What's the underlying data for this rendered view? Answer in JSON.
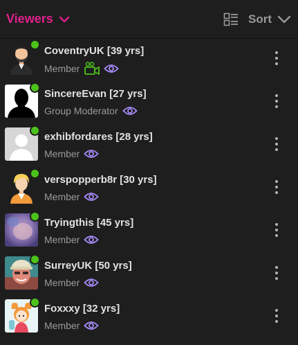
{
  "header": {
    "title": "Viewers",
    "sort_label": "Sort",
    "accent_color": "#e0208c"
  },
  "viewers": [
    {
      "name": "CoventryUK [39 yrs]",
      "role": "Member",
      "online": true,
      "camera": true,
      "avatar": "man-with-beard"
    },
    {
      "name": "SincereEvan [27 yrs]",
      "role": "Group Moderator",
      "online": true,
      "camera": false,
      "avatar": "silhouette"
    },
    {
      "name": "exhibfordares [28 yrs]",
      "role": "Member",
      "online": true,
      "camera": false,
      "avatar": "default-person"
    },
    {
      "name": "verspopperb8r [30 yrs]",
      "role": "Member",
      "online": true,
      "camera": false,
      "avatar": "blonde-cartoon"
    },
    {
      "name": "Tryingthis [45 yrs]",
      "role": "Member",
      "online": true,
      "camera": false,
      "avatar": "photo-purple"
    },
    {
      "name": "SurreyUK [50 yrs]",
      "role": "Member",
      "online": true,
      "camera": false,
      "avatar": "photo-man-cap"
    },
    {
      "name": "Foxxxy [32 yrs]",
      "role": "Member",
      "online": true,
      "camera": false,
      "avatar": "anime-character"
    }
  ],
  "colors": {
    "online": "#4cc31a",
    "camera": "#4cc31a",
    "eye": "#a78bfa",
    "muted": "#9a9a9a"
  }
}
